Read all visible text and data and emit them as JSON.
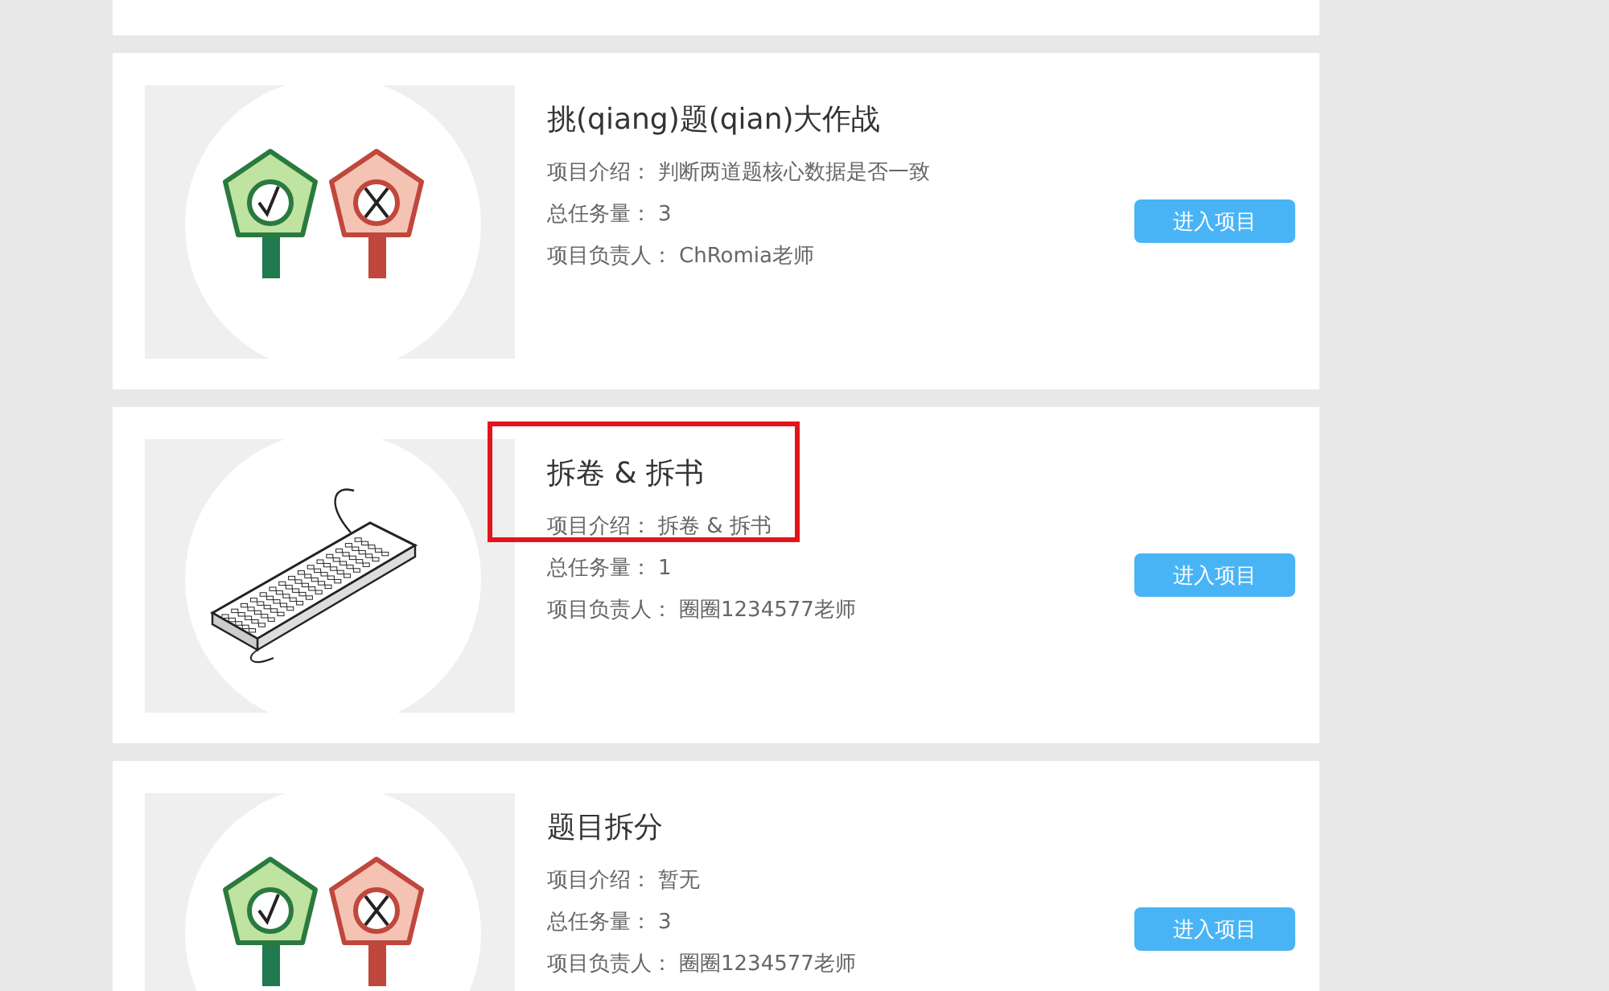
{
  "projects": [
    {
      "kind": "signposts",
      "title": "挑(qiang)题(qian)大作战",
      "highlighted": false,
      "fields": [
        {
          "label": "项目介绍：",
          "value": "判断两道题核心数据是否一致"
        },
        {
          "label": "总任务量：",
          "value": "3"
        },
        {
          "label": "项目负责人：",
          "value": "ChRomia老师"
        }
      ],
      "button": "进入项目"
    },
    {
      "kind": "keyboard",
      "title": "拆卷 & 拆书",
      "highlighted": true,
      "fields": [
        {
          "label": "项目介绍：",
          "value": "拆卷 & 拆书"
        },
        {
          "label": "总任务量：",
          "value": "1"
        },
        {
          "label": "项目负责人：",
          "value": "圈圈1234577老师"
        }
      ],
      "button": "进入项目"
    },
    {
      "kind": "signposts",
      "title": "题目拆分",
      "highlighted": false,
      "fields": [
        {
          "label": "项目介绍：",
          "value": "暂无"
        },
        {
          "label": "总任务量：",
          "value": "3"
        },
        {
          "label": "项目负责人：",
          "value": "圈圈1234577老师"
        }
      ],
      "button": "进入项目"
    }
  ]
}
